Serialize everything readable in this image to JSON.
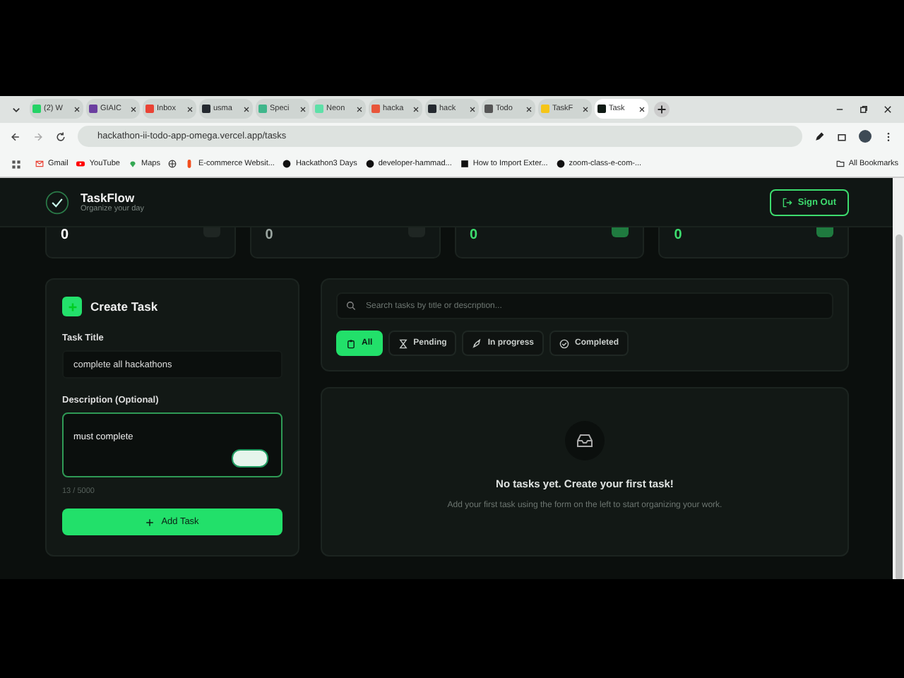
{
  "browser": {
    "tabs": [
      {
        "title": "(2) W",
        "selected": false,
        "color": "#25d366"
      },
      {
        "title": "GIAIC",
        "selected": false,
        "color": "#6b3fa0"
      },
      {
        "title": "Inbox",
        "selected": false,
        "color": "#ea4335"
      },
      {
        "title": "usma",
        "selected": false,
        "color": "#24292f"
      },
      {
        "title": "Speci",
        "selected": false,
        "color": "#3fb68b"
      },
      {
        "title": "Neon",
        "selected": false,
        "color": "#5ee0a8"
      },
      {
        "title": "hacka",
        "selected": false,
        "color": "#e8553a"
      },
      {
        "title": "hack",
        "selected": false,
        "color": "#24292f"
      },
      {
        "title": "Todo",
        "selected": false,
        "color": "#555555"
      },
      {
        "title": "TaskF",
        "selected": false,
        "color": "#f5c518"
      },
      {
        "title": "Task",
        "selected": true,
        "color": "#0f1a14"
      }
    ],
    "url": "hackathon-ii-todo-app-omega.vercel.app/tasks",
    "bookmarks": [
      {
        "kind": "mail",
        "label": "Gmail"
      },
      {
        "kind": "video",
        "label": "YouTube"
      },
      {
        "kind": "pin",
        "label": "Maps"
      },
      {
        "kind": "globe"
      },
      {
        "kind": "figma",
        "label": "E-commerce Websit..."
      },
      {
        "kind": "github",
        "label": "Hackathon3 Days"
      },
      {
        "kind": "github",
        "label": "developer-hammad..."
      },
      {
        "kind": "square",
        "label": "How to Import Exter..."
      },
      {
        "kind": "github",
        "label": "zoom-class-e-com-..."
      }
    ],
    "all_bookmarks": "All Bookmarks"
  },
  "app": {
    "brand": "TaskFlow",
    "tagline": "Organize your day",
    "sign_out": "Sign Out"
  },
  "stats": [
    {
      "value": "0",
      "color": "#ffffff"
    },
    {
      "value": "0",
      "color": "#9aa5a0"
    },
    {
      "value": "0",
      "color": "#3ddc6e"
    },
    {
      "value": "0",
      "color": "#3ddc6e"
    }
  ],
  "form": {
    "heading": "Create Task",
    "title_label": "Task Title",
    "title_value": "complete all hackathons",
    "desc_label": "Description (Optional)",
    "desc_value": "must complete",
    "counter": "13 / 5000",
    "submit": "Add Task"
  },
  "search": {
    "placeholder": "Search tasks by title or description..."
  },
  "filters": [
    {
      "kind": "all",
      "label": "All",
      "selected": true
    },
    {
      "kind": "pending",
      "label": "Pending",
      "selected": false
    },
    {
      "kind": "progress",
      "label": "In progress",
      "selected": false
    },
    {
      "kind": "completed",
      "label": "Completed",
      "selected": false
    }
  ],
  "empty": {
    "title": "No tasks yet. Create your first task!",
    "text": "Add your first task using the form on the left to start organizing your work."
  }
}
